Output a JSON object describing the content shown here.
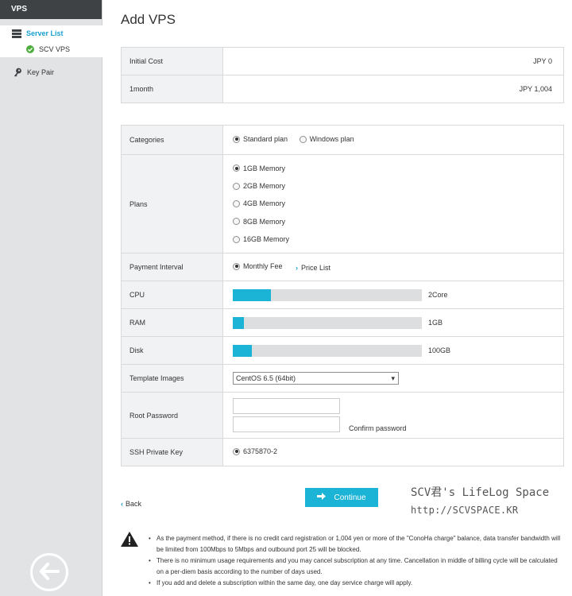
{
  "sidebar": {
    "header": "VPS",
    "server_list": "Server List",
    "server_name": "SCV VPS",
    "key_pair": "Key Pair"
  },
  "page_title": "Add VPS",
  "cost": {
    "initial_label": "Initial Cost",
    "initial_value": "JPY 0",
    "month_label": "1month",
    "month_value": "JPY 1,004"
  },
  "form": {
    "categories_label": "Categories",
    "categories": [
      {
        "label": "Standard plan",
        "selected": true
      },
      {
        "label": "Windows plan",
        "selected": false
      }
    ],
    "plans_label": "Plans",
    "plans": [
      {
        "label": "1GB Memory",
        "selected": true
      },
      {
        "label": "2GB Memory",
        "selected": false
      },
      {
        "label": "4GB Memory",
        "selected": false
      },
      {
        "label": "8GB Memory",
        "selected": false
      },
      {
        "label": "16GB Memory",
        "selected": false
      }
    ],
    "payment_label": "Payment Interval",
    "payment_option": "Monthly Fee",
    "price_list": "Price List",
    "cpu_label": "CPU",
    "cpu_value": "2Core",
    "cpu_fill": 0.2,
    "ram_label": "RAM",
    "ram_value": "1GB",
    "ram_fill": 0.06,
    "disk_label": "Disk",
    "disk_value": "100GB",
    "disk_fill": 0.1,
    "template_label": "Template Images",
    "template_value": "CentOS 6.5 (64bit)",
    "root_pw_label": "Root Password",
    "confirm_pw": "Confirm password",
    "ssh_label": "SSH Private Key",
    "ssh_value": "6375870-2"
  },
  "actions": {
    "back": "Back",
    "continue": "Continue"
  },
  "watermark": {
    "line1": "SCV君's LifeLog Space",
    "line2": "http://SCVSPACE.KR"
  },
  "notices": [
    "As the payment method, if there is no credit card registration or 1,004 yen or more of the \"ConoHa charge\" balance, data transfer bandwidth will be limited from 100Mbps to 5Mbps and outbound port 25 will be blocked.",
    "There is no minimum usage requirements and you may cancel subscription at any time. Cancellation in middle of billing cycle will be calculated on a per-diem basis according to the number of days used.",
    "If you add and delete a subscription within the same day, one day service charge will apply."
  ],
  "colors": {
    "accent": "#1bb3d6",
    "link": "#1aa0cf",
    "sidebar_bg": "#e1e3e4",
    "sidebar_header": "#3f4245",
    "success": "#4caf3c"
  }
}
